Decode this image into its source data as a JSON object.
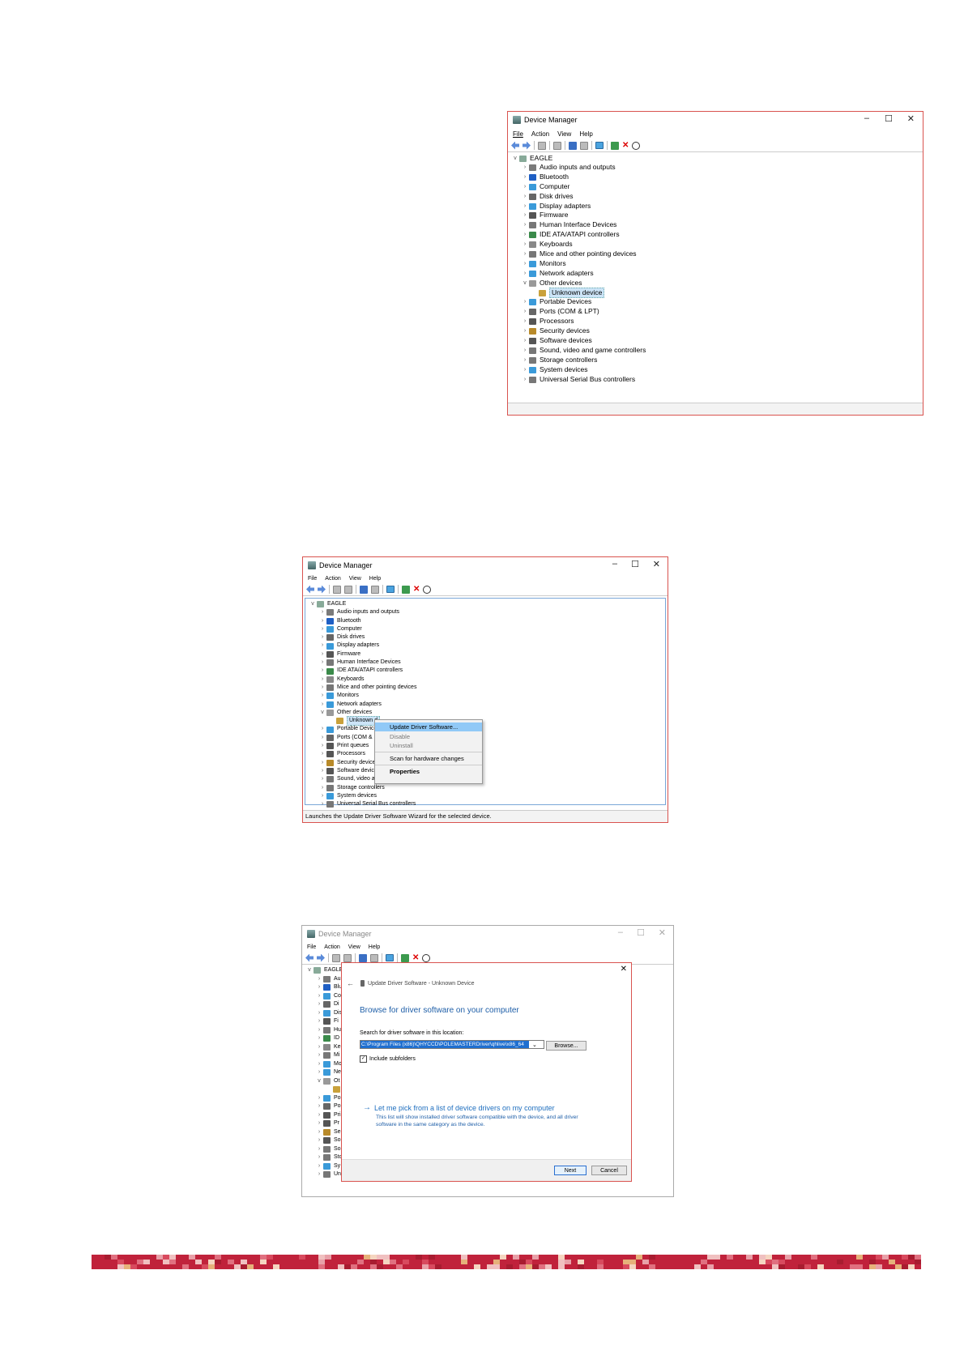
{
  "window1": {
    "title": "Device Manager",
    "menu": [
      "File",
      "Action",
      "View",
      "Help"
    ],
    "root": "EAGLE",
    "items": [
      {
        "label": "Audio inputs and outputs",
        "color": "#7a7a7a",
        "chev": ">"
      },
      {
        "label": "Bluetooth",
        "color": "#1f5fc4",
        "chev": ">"
      },
      {
        "label": "Computer",
        "color": "#3a9ad9",
        "chev": ">"
      },
      {
        "label": "Disk drives",
        "color": "#666",
        "chev": ">"
      },
      {
        "label": "Display adapters",
        "color": "#3a9ad9",
        "chev": ">"
      },
      {
        "label": "Firmware",
        "color": "#555",
        "chev": ">"
      },
      {
        "label": "Human Interface Devices",
        "color": "#777",
        "chev": ">"
      },
      {
        "label": "IDE ATA/ATAPI controllers",
        "color": "#3a8a4a",
        "chev": ">"
      },
      {
        "label": "Keyboards",
        "color": "#888",
        "chev": ">"
      },
      {
        "label": "Mice and other pointing devices",
        "color": "#777",
        "chev": ">"
      },
      {
        "label": "Monitors",
        "color": "#3a9ad9",
        "chev": ">"
      },
      {
        "label": "Network adapters",
        "color": "#3a9ad9",
        "chev": ">"
      },
      {
        "label": "Other devices",
        "color": "#999",
        "chev": "v"
      },
      {
        "label": "Unknown device",
        "color": "#c9a13b",
        "chev": "",
        "child": true,
        "selected": true
      },
      {
        "label": "Portable Devices",
        "color": "#3a9ad9",
        "chev": ">"
      },
      {
        "label": "Ports (COM & LPT)",
        "color": "#666",
        "chev": ">"
      },
      {
        "label": "Processors",
        "color": "#555",
        "chev": ">"
      },
      {
        "label": "Security devices",
        "color": "#b88a2a",
        "chev": ">"
      },
      {
        "label": "Software devices",
        "color": "#555",
        "chev": ">"
      },
      {
        "label": "Sound, video and game controllers",
        "color": "#777",
        "chev": ">"
      },
      {
        "label": "Storage controllers",
        "color": "#777",
        "chev": ">"
      },
      {
        "label": "System devices",
        "color": "#3a9ad9",
        "chev": ">"
      },
      {
        "label": "Universal Serial Bus controllers",
        "color": "#777",
        "chev": ">"
      }
    ]
  },
  "window2": {
    "title": "Device Manager",
    "menu": [
      "File",
      "Action",
      "View",
      "Help"
    ],
    "root": "EAGLE",
    "items": [
      {
        "label": "Audio inputs and outputs",
        "color": "#7a7a7a",
        "chev": ">"
      },
      {
        "label": "Bluetooth",
        "color": "#1f5fc4",
        "chev": ">"
      },
      {
        "label": "Computer",
        "color": "#3a9ad9",
        "chev": ">"
      },
      {
        "label": "Disk drives",
        "color": "#666",
        "chev": ">"
      },
      {
        "label": "Display adapters",
        "color": "#3a9ad9",
        "chev": ">"
      },
      {
        "label": "Firmware",
        "color": "#555",
        "chev": ">"
      },
      {
        "label": "Human Interface Devices",
        "color": "#777",
        "chev": ">"
      },
      {
        "label": "IDE ATA/ATAPI controllers",
        "color": "#3a8a4a",
        "chev": ">"
      },
      {
        "label": "Keyboards",
        "color": "#888",
        "chev": ">"
      },
      {
        "label": "Mice and other pointing devices",
        "color": "#777",
        "chev": ">"
      },
      {
        "label": "Monitors",
        "color": "#3a9ad9",
        "chev": ">"
      },
      {
        "label": "Network adapters",
        "color": "#3a9ad9",
        "chev": ">"
      },
      {
        "label": "Other devices",
        "color": "#999",
        "chev": "v"
      },
      {
        "label": "Unknown d",
        "color": "#c9a13b",
        "chev": "",
        "child": true,
        "selected": true
      },
      {
        "label": "Portable Device",
        "color": "#3a9ad9",
        "chev": ">"
      },
      {
        "label": "Ports (COM &",
        "color": "#666",
        "chev": ">"
      },
      {
        "label": "Print queues",
        "color": "#555",
        "chev": ">"
      },
      {
        "label": "Processors",
        "color": "#555",
        "chev": ">"
      },
      {
        "label": "Security device",
        "color": "#b88a2a",
        "chev": ">"
      },
      {
        "label": "Software devic",
        "color": "#555",
        "chev": ">"
      },
      {
        "label": "Sound, video a",
        "color": "#777",
        "chev": ">"
      },
      {
        "label": "Storage controllers",
        "color": "#777",
        "chev": ">"
      },
      {
        "label": "System devices",
        "color": "#3a9ad9",
        "chev": ">"
      },
      {
        "label": "Universal Serial Bus controllers",
        "color": "#777",
        "chev": ">"
      }
    ],
    "context_menu": {
      "update": "Update Driver Software...",
      "disable": "Disable",
      "uninstall": "Uninstall",
      "scan": "Scan for hardware changes",
      "properties": "Properties"
    },
    "status": "Launches the Update Driver Software Wizard for the selected device."
  },
  "window3": {
    "title": "Device Manager",
    "menu": [
      "File",
      "Action",
      "View",
      "Help"
    ],
    "root": "EAGLE",
    "items": [
      {
        "label": "Au",
        "color": "#7a7a7a",
        "chev": ">"
      },
      {
        "label": "Blu",
        "color": "#1f5fc4",
        "chev": ">"
      },
      {
        "label": "Co",
        "color": "#3a9ad9",
        "chev": ">"
      },
      {
        "label": "Di",
        "color": "#666",
        "chev": ">"
      },
      {
        "label": "Dis",
        "color": "#3a9ad9",
        "chev": ">"
      },
      {
        "label": "Fi",
        "color": "#555",
        "chev": ">"
      },
      {
        "label": "Hu",
        "color": "#777",
        "chev": ">"
      },
      {
        "label": "ID",
        "color": "#3a8a4a",
        "chev": ">"
      },
      {
        "label": "Ke",
        "color": "#888",
        "chev": ">"
      },
      {
        "label": "Mi",
        "color": "#777",
        "chev": ">"
      },
      {
        "label": "Mo",
        "color": "#3a9ad9",
        "chev": ">"
      },
      {
        "label": "Ne",
        "color": "#3a9ad9",
        "chev": ">"
      },
      {
        "label": "Ot",
        "color": "#999",
        "chev": "v"
      },
      {
        "label": "",
        "color": "#c9a13b",
        "chev": "",
        "child": true
      },
      {
        "label": "Po",
        "color": "#3a9ad9",
        "chev": ">"
      },
      {
        "label": "Po",
        "color": "#666",
        "chev": ">"
      },
      {
        "label": "Pri",
        "color": "#555",
        "chev": ">"
      },
      {
        "label": "Pr",
        "color": "#555",
        "chev": ">"
      },
      {
        "label": "Se",
        "color": "#b88a2a",
        "chev": ">"
      },
      {
        "label": "So",
        "color": "#555",
        "chev": ">"
      },
      {
        "label": "So",
        "color": "#777",
        "chev": ">"
      },
      {
        "label": "Sto",
        "color": "#777",
        "chev": ">"
      },
      {
        "label": "Sy",
        "color": "#3a9ad9",
        "chev": ">"
      },
      {
        "label": "Un",
        "color": "#777",
        "chev": ">"
      }
    ]
  },
  "wizard": {
    "header": "Update Driver Software - Unknown Device",
    "heading": "Browse for driver software on your computer",
    "search_label": "Search for driver software in this location:",
    "path_value": "C:\\Program Files (x86)\\QHYCCD\\POLEMASTERDriver\\qhlive\\x86_64",
    "browse": "Browse...",
    "include_subfolders": "Include subfolders",
    "pick_title": "Let me pick from a list of device drivers on my computer",
    "pick_desc": "This list will show installed driver software compatible with the device, and all driver software in the same category as the device.",
    "next": "Next",
    "cancel": "Cancel"
  },
  "colors": {
    "accent": "#d9534f",
    "link": "#1f6fbf",
    "selection": "#cce4f7"
  }
}
